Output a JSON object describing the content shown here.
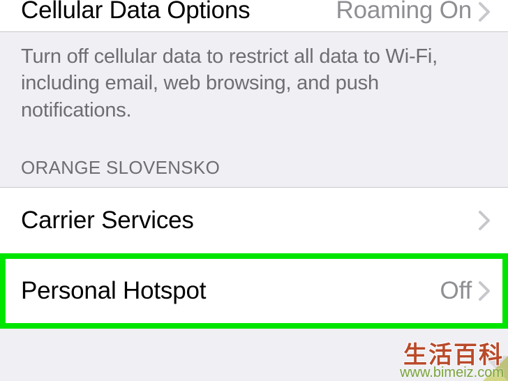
{
  "cells": {
    "cellular_data_options": {
      "label": "Cellular Data Options",
      "value": "Roaming On"
    },
    "carrier_services": {
      "label": "Carrier Services"
    },
    "personal_hotspot": {
      "label": "Personal Hotspot",
      "value": "Off"
    }
  },
  "description": "Turn off cellular data to restrict all data to Wi-Fi, including email, web browsing, and push notifications.",
  "section_header": "ORANGE SLOVENSKO",
  "watermark": {
    "cn": "生活百科",
    "url": "www.bimeiz.com"
  }
}
